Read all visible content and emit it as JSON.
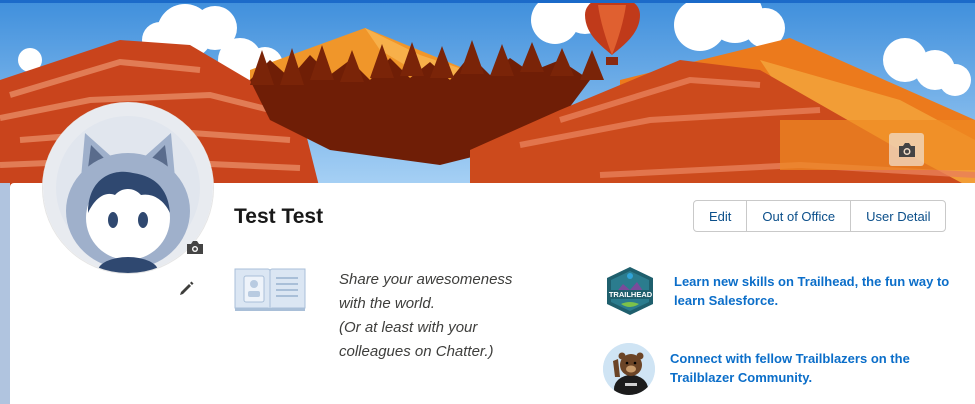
{
  "profile": {
    "name": "Test Test",
    "share_lines": [
      "Share your awesomeness",
      "with the world.",
      "(Or at least with your",
      "colleagues on Chatter.)"
    ]
  },
  "actions": {
    "edit_label": "Edit",
    "out_of_office_label": "Out of Office",
    "user_detail_label": "User Detail"
  },
  "promos": [
    {
      "text_line1": "Learn new skills on Trailhead, the fun way to",
      "text_line2": "learn Salesforce.",
      "icon": "trailhead-badge-icon",
      "badge_text": "TRAILHEAD"
    },
    {
      "text_line1": "Connect with fellow Trailblazers on the",
      "text_line2": "Trailblazer Community.",
      "icon": "trailblazer-bear-icon"
    }
  ],
  "icons": {
    "banner_camera": "camera-icon",
    "avatar_camera": "camera-icon",
    "edit_pencil": "pencil-icon",
    "chatter_book": "book-icon"
  },
  "colors": {
    "link": "#0b6ec9",
    "button_text": "#0b4f8a",
    "banner_sky": "#5fa6e8",
    "mountain_red": "#c9441c",
    "mountain_orange": "#e8741a"
  }
}
